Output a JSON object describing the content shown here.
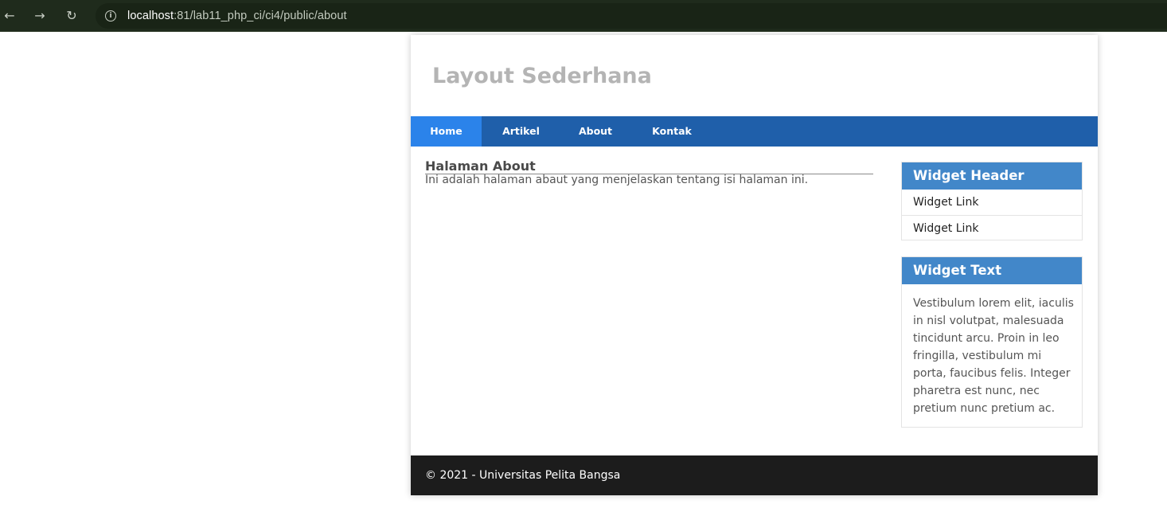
{
  "browser": {
    "url_host": "localhost",
    "url_rest": ":81/lab11_php_ci/ci4/public/about",
    "back_icon": "arrow-left-icon",
    "forward_icon": "arrow-right-icon",
    "reload_icon": "reload-icon",
    "info_icon": "info-icon"
  },
  "site": {
    "title": "Layout Sederhana"
  },
  "nav": {
    "items": [
      {
        "label": "Home",
        "active": true
      },
      {
        "label": "Artikel",
        "active": false
      },
      {
        "label": "About",
        "active": false
      },
      {
        "label": "Kontak",
        "active": false
      }
    ]
  },
  "main": {
    "heading": "Halaman About",
    "text": "Ini adalah halaman abaut yang menjelaskan tentang isi halaman ini."
  },
  "sidebar": {
    "widget1": {
      "header": "Widget Header",
      "links": [
        "Widget Link",
        "Widget Link"
      ]
    },
    "widget2": {
      "header": "Widget Text",
      "body": "Vestibulum lorem elit, iaculis in nisl volutpat, malesuada tincidunt arcu. Proin in leo fringilla, vestibulum mi porta, faucibus felis. Integer pharetra est nunc, nec pretium nunc pretium ac."
    }
  },
  "footer": {
    "text": "© 2021 - Universitas Pelita Bangsa"
  },
  "colors": {
    "nav_bg": "#1f5faa",
    "nav_active": "#2b83ea",
    "widget_header": "#4287c9",
    "footer_bg": "#1c1c1c",
    "title": "#b4b4b4"
  }
}
